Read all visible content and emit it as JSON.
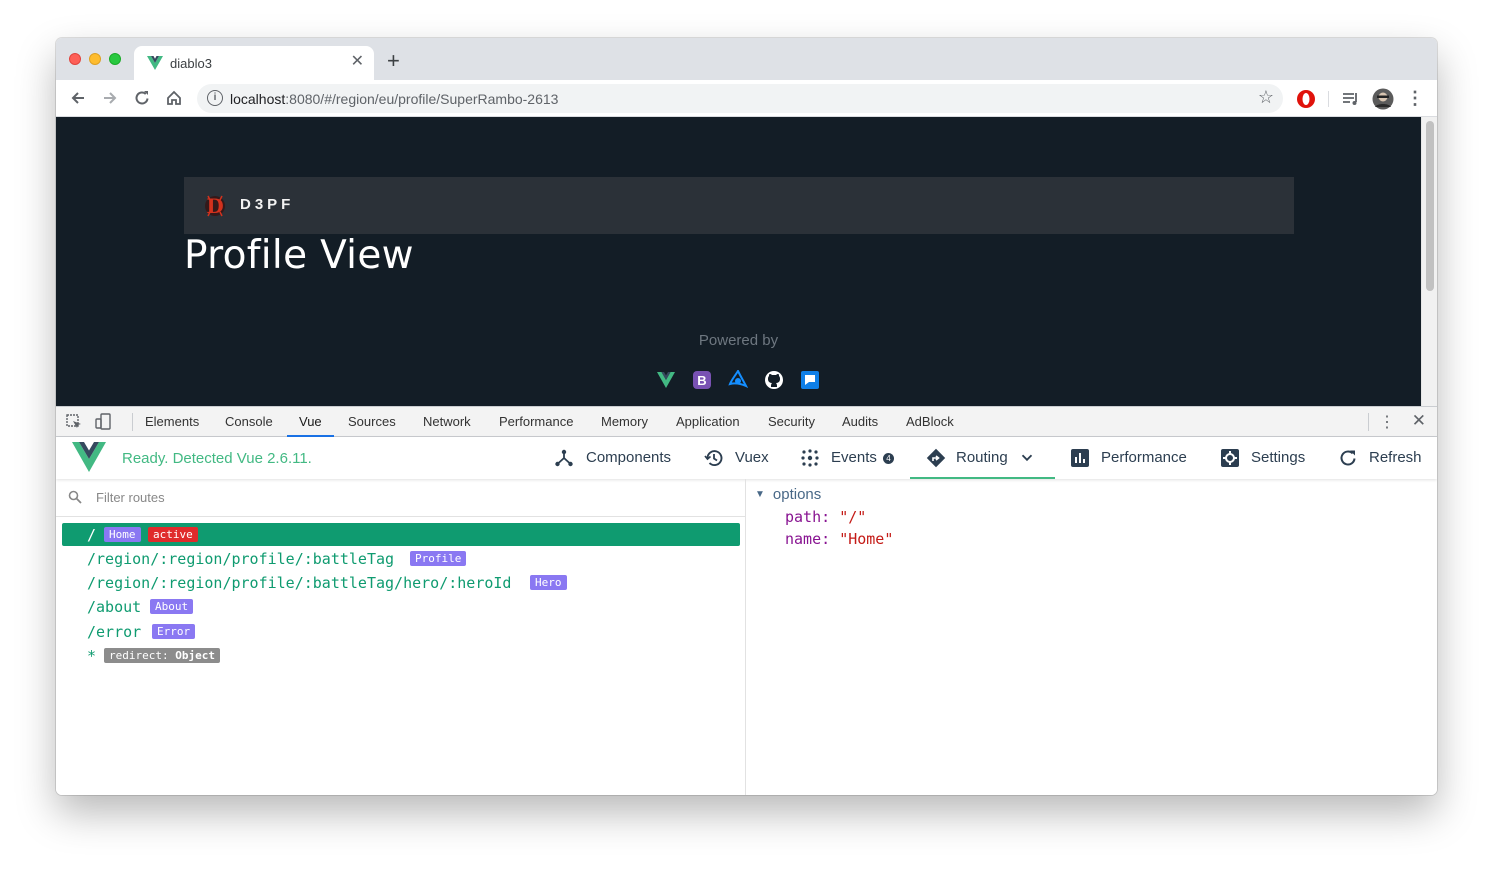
{
  "browser": {
    "tab_title": "diablo3",
    "url_host": "localhost",
    "url_rest": ":8080/#/region/eu/profile/SuperRambo-2613"
  },
  "site": {
    "brand": "D3PF",
    "title": "Profile View",
    "powered_by": "Powered by"
  },
  "devtools": {
    "tabs": [
      "Elements",
      "Console",
      "Vue",
      "Sources",
      "Network",
      "Performance",
      "Memory",
      "Application",
      "Security",
      "Audits",
      "AdBlock"
    ],
    "active_tab": "Vue"
  },
  "vue": {
    "status": "Ready. Detected Vue 2.6.11.",
    "nav": {
      "components": "Components",
      "vuex": "Vuex",
      "events": "Events",
      "events_badge": "4",
      "routing": "Routing",
      "performance": "Performance",
      "settings": "Settings",
      "refresh": "Refresh"
    },
    "filter_placeholder": "Filter routes",
    "routes": [
      {
        "path": "/",
        "tag": "Home",
        "status": "active"
      },
      {
        "path": "/region/:region/profile/:battleTag",
        "tag": "Profile"
      },
      {
        "path": "/region/:region/profile/:battleTag/hero/:heroId",
        "tag": "Hero"
      },
      {
        "path": "/about",
        "tag": "About"
      },
      {
        "path": "/error",
        "tag": "Error"
      },
      {
        "path": "*",
        "tag_key": "redirect:",
        "tag_value": "Object"
      }
    ],
    "options": {
      "label": "options",
      "path_key": "path:",
      "path_value": "\"/\"",
      "name_key": "name:",
      "name_value": "\"Home\""
    }
  }
}
